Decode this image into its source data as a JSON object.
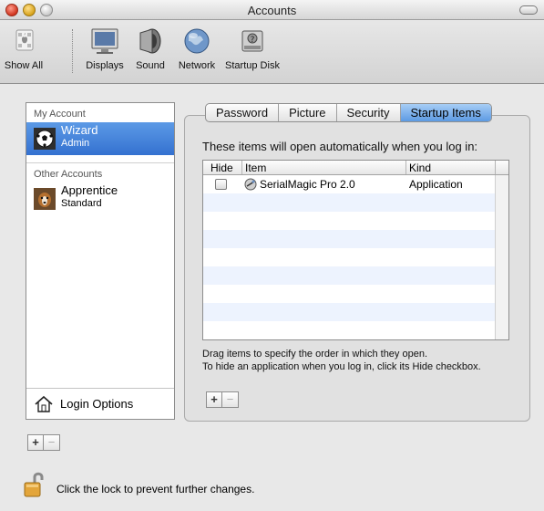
{
  "window": {
    "title": "Accounts"
  },
  "toolbar": {
    "items": [
      {
        "label": "Show All",
        "icon": "apple-grid-icon"
      },
      {
        "label": "Displays",
        "icon": "display-icon"
      },
      {
        "label": "Sound",
        "icon": "speaker-icon"
      },
      {
        "label": "Network",
        "icon": "globe-icon"
      },
      {
        "label": "Startup Disk",
        "icon": "hard-disk-icon"
      }
    ]
  },
  "sidebar": {
    "my_account_header": "My Account",
    "other_accounts_header": "Other Accounts",
    "accounts": [
      {
        "name": "Wizard",
        "role": "Admin",
        "selected": true,
        "avatar": "soccer-ball-icon"
      },
      {
        "name": "Apprentice",
        "role": "Standard",
        "selected": false,
        "avatar": "dog-photo-icon"
      }
    ],
    "login_options_label": "Login Options",
    "add_button": "+",
    "remove_button": "−"
  },
  "tabs": [
    "Password",
    "Picture",
    "Security",
    "Startup Items"
  ],
  "active_tab": "Startup Items",
  "startup": {
    "intro": "These items will open automatically when you log in:",
    "columns": {
      "hide": "Hide",
      "item": "Item",
      "kind": "Kind"
    },
    "rows": [
      {
        "hide": false,
        "item": "SerialMagic Pro 2.0",
        "kind": "Application"
      }
    ],
    "hint_line1": "Drag items to specify the order in which they open.",
    "hint_line2": "To hide an application when you log in, click its Hide checkbox.",
    "add_button": "+",
    "remove_button": "−"
  },
  "lock": {
    "text": "Click the lock to prevent further changes."
  },
  "colors": {
    "selection": "#3b7bd8",
    "tab_active": "#7fb2ec",
    "row_stripe": "#edf3fe"
  }
}
